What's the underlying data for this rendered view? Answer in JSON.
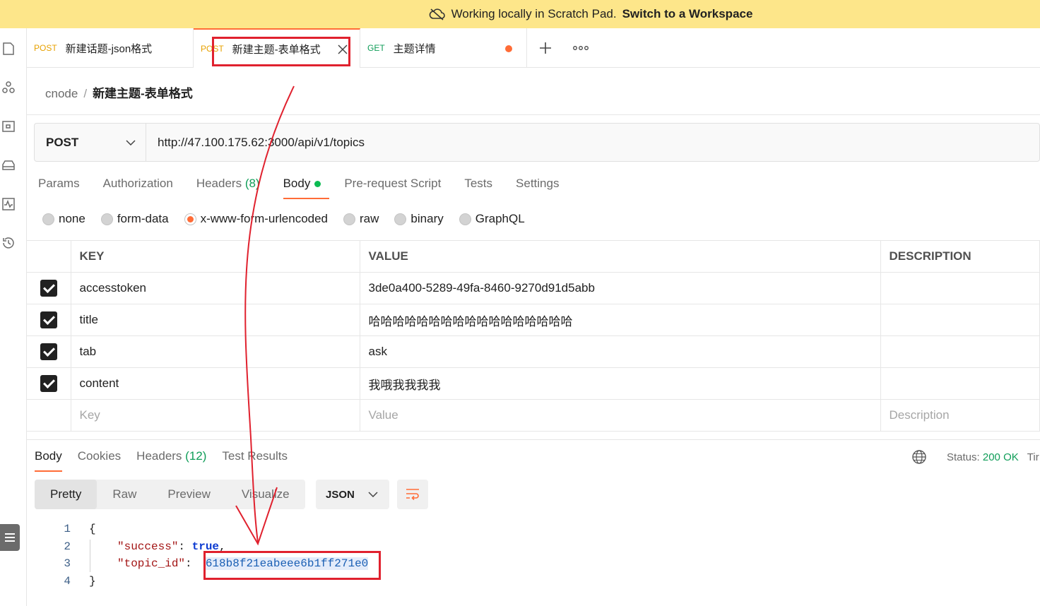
{
  "banner": {
    "text": "Working locally in Scratch Pad.",
    "link": "Switch to a Workspace"
  },
  "tabs": [
    {
      "method": "POST",
      "label": "新建话题-json格式"
    },
    {
      "method": "POST",
      "label": "新建主题-表单格式"
    },
    {
      "method": "GET",
      "label": "主题详情"
    }
  ],
  "breadcrumb": {
    "collection": "cnode",
    "sep": "/",
    "request": "新建主题-表单格式"
  },
  "request": {
    "method": "POST",
    "url": "http://47.100.175.62:3000/api/v1/topics"
  },
  "req_tabs": {
    "params": "Params",
    "authorization": "Authorization",
    "headers": "Headers",
    "headers_count": "(8)",
    "body": "Body",
    "prerequest": "Pre-request Script",
    "tests": "Tests",
    "settings": "Settings"
  },
  "body_types": [
    "none",
    "form-data",
    "x-www-form-urlencoded",
    "raw",
    "binary",
    "GraphQL"
  ],
  "table": {
    "headers": {
      "key": "KEY",
      "value": "VALUE",
      "description": "DESCRIPTION"
    },
    "rows": [
      {
        "key": "accesstoken",
        "value": "3de0a400-5289-49fa-8460-9270d91d5abb"
      },
      {
        "key": "title",
        "value": "哈哈哈哈哈哈哈哈哈哈哈哈哈哈哈哈哈"
      },
      {
        "key": "tab",
        "value": "ask"
      },
      {
        "key": "content",
        "value": "我哦我我我我"
      }
    ],
    "placeholders": {
      "key": "Key",
      "value": "Value",
      "description": "Description"
    }
  },
  "res_tabs": {
    "body": "Body",
    "cookies": "Cookies",
    "headers": "Headers",
    "headers_count": "(12)",
    "test_results": "Test Results"
  },
  "status": {
    "label": "Status:",
    "value": "200 OK",
    "time": "Tir"
  },
  "view_modes": [
    "Pretty",
    "Raw",
    "Preview",
    "Visualize"
  ],
  "format": "JSON",
  "code": {
    "lines": [
      "1",
      "2",
      "3",
      "4"
    ],
    "open": "{",
    "success_key": "\"success\"",
    "success_val": "true",
    "topic_key": "\"topic_id\"",
    "topic_val": "618b8f21eabeee6b1ff271e0",
    "close": "}"
  },
  "colors": {
    "accent": "#ff6c37",
    "annotation": "#e0212e",
    "banner": "#fde68a",
    "ok": "#0f9d58"
  }
}
